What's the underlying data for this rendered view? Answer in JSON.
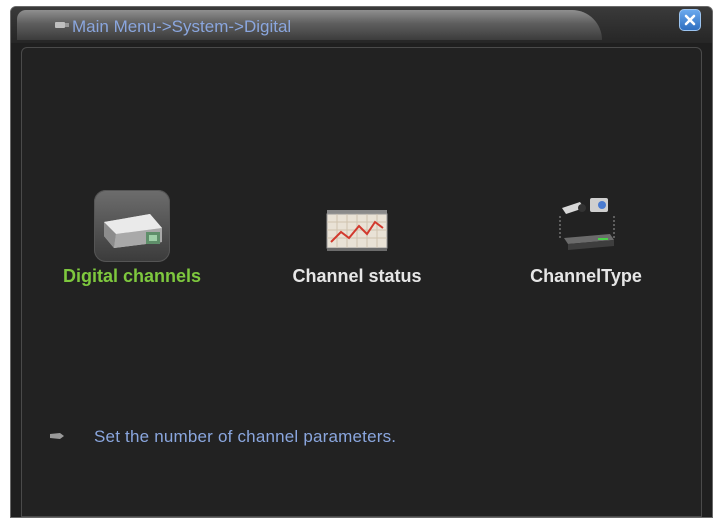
{
  "window": {
    "breadcrumb": "Main Menu->System->Digital",
    "close_icon": "close-x-icon"
  },
  "menu": {
    "items": [
      {
        "label": "Digital channels",
        "icon": "camera-icon",
        "selected": true
      },
      {
        "label": "Channel status",
        "icon": "line-chart-icon",
        "selected": false
      },
      {
        "label": "ChannelType",
        "icon": "camera-nvr-icon",
        "selected": false
      }
    ]
  },
  "status": {
    "hint": "Set the number of channel parameters.",
    "icon": "pointer-icon"
  },
  "colors": {
    "title_text": "#8aa6de",
    "selected_label": "#7ec83e",
    "label": "#e6e6e6",
    "background": "#222222"
  }
}
